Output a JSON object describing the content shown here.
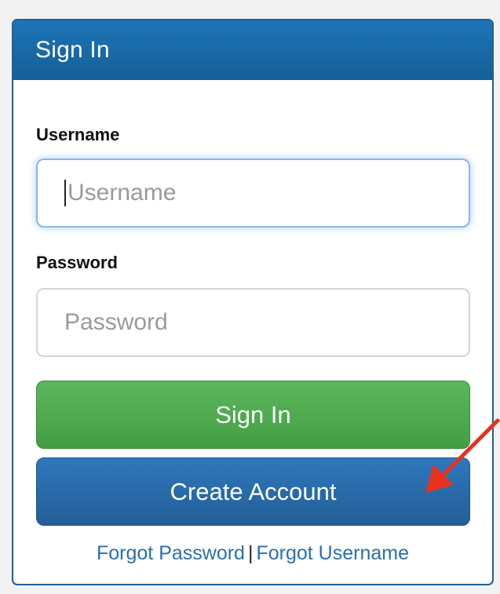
{
  "panel": {
    "title": "Sign In"
  },
  "username": {
    "label": "Username",
    "placeholder": "Username",
    "value": ""
  },
  "password": {
    "label": "Password",
    "placeholder": "Password",
    "value": ""
  },
  "buttons": {
    "sign_in": "Sign In",
    "create_account": "Create Account"
  },
  "links": {
    "forgot_password": "Forgot Password",
    "separator": "|",
    "forgot_username": "Forgot Username"
  },
  "colors": {
    "header": "#1a6aa9",
    "sign_in_button": "#4fab4f",
    "create_button": "#2a6aaa",
    "link": "#2a6fad",
    "arrow": "#e8321e"
  },
  "annotation": {
    "icon": "red-arrow-icon"
  }
}
